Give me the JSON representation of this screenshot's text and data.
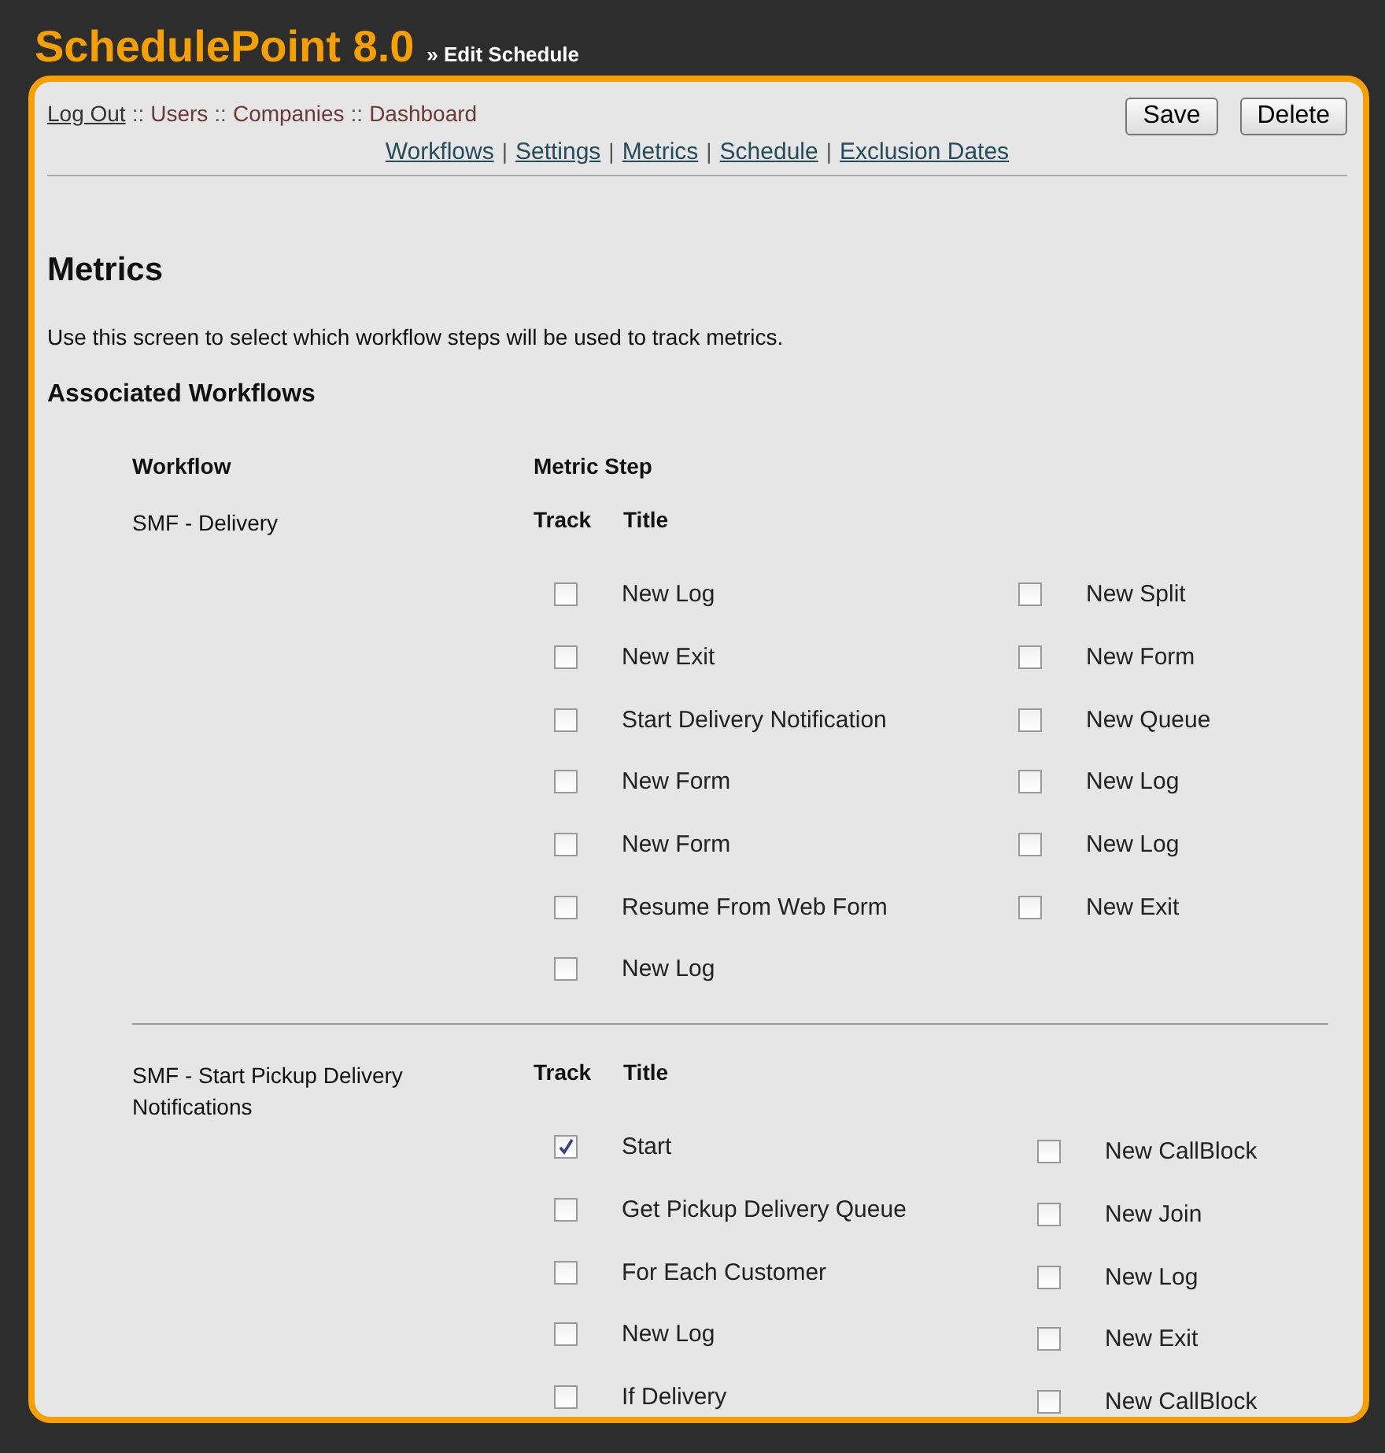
{
  "app": {
    "title": "SchedulePoint 8.0",
    "subtitle": "» Edit Schedule"
  },
  "breadcrumb": [
    {
      "label": "Log Out",
      "kind": "link"
    },
    {
      "separator": "::",
      "label": "Users",
      "kind": "text"
    },
    {
      "separator": "::",
      "label": "Companies",
      "kind": "text"
    },
    {
      "separator": "::",
      "label": "Dashboard",
      "kind": "text"
    }
  ],
  "buttons": [
    "Save",
    "Delete"
  ],
  "nav": [
    {
      "label": "Workflows"
    },
    {
      "separator": "|",
      "label": "Settings"
    },
    {
      "separator": "|",
      "label": "Metrics"
    },
    {
      "separator": "|",
      "label": "Schedule"
    },
    {
      "separator": "|",
      "label": "Exclusion Dates"
    }
  ],
  "heading": "Metrics",
  "description": "Use this screen to select which workflow steps will be used to track metrics.",
  "subheading": "Associated Workflows",
  "columns": {
    "workflow": "Workflow",
    "metric_step": "Metric Step"
  },
  "workflows": [
    {
      "name": "SMF - Delivery",
      "track_label": "Track",
      "title_label": "Title",
      "left_steps": [
        {
          "title": "New Log",
          "checked": false
        },
        {
          "title": "New Exit",
          "checked": false
        },
        {
          "title": "Start Delivery Notification",
          "checked": false
        },
        {
          "title": "New Form",
          "checked": false
        },
        {
          "title": "New Form",
          "checked": false
        },
        {
          "title": "Resume From Web Form",
          "checked": false
        },
        {
          "title": "New Log",
          "checked": false
        }
      ],
      "right_steps": [
        {
          "title": "New Split",
          "checked": false
        },
        {
          "title": "New Form",
          "checked": false
        },
        {
          "title": "New Queue",
          "checked": false
        },
        {
          "title": "New Log",
          "checked": false
        },
        {
          "title": "New Log",
          "checked": false
        },
        {
          "title": "New Exit",
          "checked": false
        }
      ]
    },
    {
      "name": "SMF - Start Pickup Delivery Notifications",
      "track_label": "Track",
      "title_label": "Title",
      "left_steps": [
        {
          "title": "Start",
          "checked": true
        },
        {
          "title": "Get Pickup Delivery Queue",
          "checked": false
        },
        {
          "title": "For Each Customer",
          "checked": false
        },
        {
          "title": "New Log",
          "checked": false
        },
        {
          "title": "If Delivery",
          "checked": false
        }
      ],
      "right_steps": [
        {
          "title": "New CallBlock",
          "checked": false
        },
        {
          "title": "New Join",
          "checked": false
        },
        {
          "title": "New Log",
          "checked": false
        },
        {
          "title": "New Exit",
          "checked": false
        },
        {
          "title": "New CallBlock",
          "checked": false
        }
      ]
    }
  ]
}
